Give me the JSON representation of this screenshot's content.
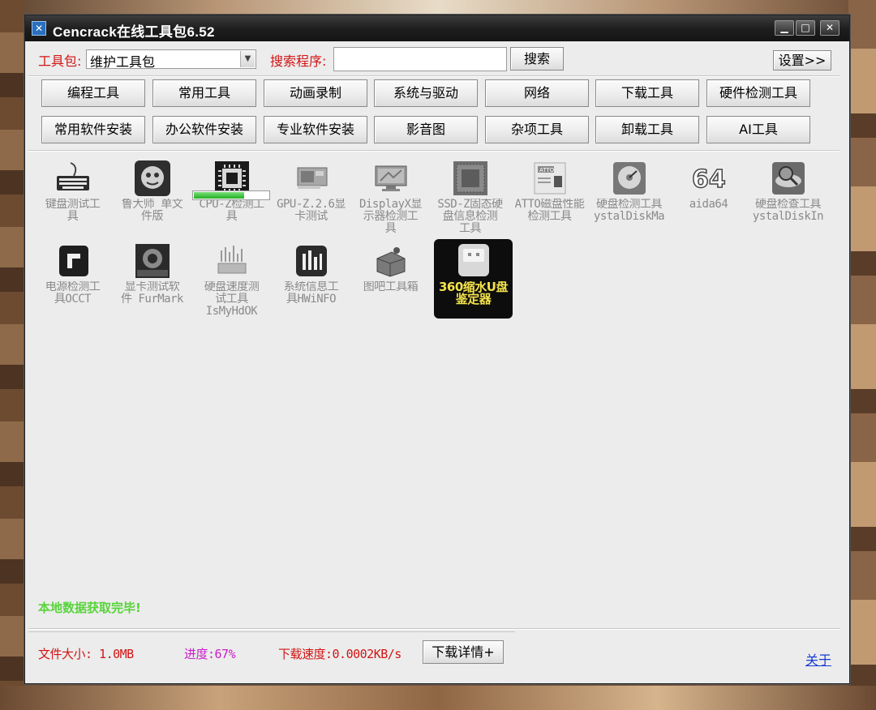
{
  "window": {
    "title": "Cencrack在线工具包6.52",
    "controls": [
      "minimize-icon",
      "maximize-icon",
      "close-icon"
    ]
  },
  "toolbar": {
    "toolkit_label": "工具包:",
    "toolkit_value": "维护工具包",
    "search_label": "搜索程序:",
    "search_value": "",
    "search_button": "搜索",
    "settings_button": "设置>>"
  },
  "categories": {
    "row1": [
      "编程工具",
      "常用工具",
      "动画录制",
      "系统与驱动",
      "网络",
      "下载工具",
      "硬件检测工具"
    ],
    "row2": [
      "常用软件安装",
      "办公软件安装",
      "专业软件安装",
      "影音图",
      "杂项工具",
      "卸载工具",
      "AI工具"
    ]
  },
  "tools": [
    {
      "label": "键盘测试工\n具",
      "icon": "keyboard-icon"
    },
    {
      "label": "鲁大师_单文\n件版",
      "icon": "ludashi-icon"
    },
    {
      "label": "CPU-Z检测工\n具",
      "icon": "cpu-chip-icon"
    },
    {
      "label": "GPU-Z.2.6显\n卡测试",
      "icon": "graphics-card-icon"
    },
    {
      "label": "DisplayX显\n示器检测工\n具",
      "icon": "monitor-icon"
    },
    {
      "label": "SSD-Z固态硬\n盘信息检测\n工具",
      "icon": "ssd-icon"
    },
    {
      "label": "ATTO磁盘性能\n检测工具",
      "icon": "atto-icon"
    },
    {
      "label": "硬盘检测工具\nystalDiskMa",
      "icon": "crystaldiskmark-icon"
    },
    {
      "label": "aida64",
      "icon": "aida64-icon"
    },
    {
      "label": "硬盘检查工具\nystalDiskIn",
      "icon": "crystaldiskinfo-icon"
    },
    {
      "label": "电源检测工\n具OCCT",
      "icon": "occt-icon"
    },
    {
      "label": "显卡测试软\n件 FurMark",
      "icon": "furmark-icon"
    },
    {
      "label": "硬盘速度测\n试工具\nIsMyHdOK",
      "icon": "hdd-speed-icon"
    },
    {
      "label": "系统信息工\n具HWiNFO",
      "icon": "hwinfo-icon"
    },
    {
      "label": "图吧工具箱",
      "icon": "toolbox-icon"
    },
    {
      "label": "360缩水U盘\n鉴定器",
      "icon": "usb-drive-icon"
    }
  ],
  "download_progress_fraction": 0.67,
  "status": {
    "message": "本地数据获取完毕!",
    "file_size": "文件大小: 1.0MB",
    "progress": "进度:67%",
    "speed": "下载速度:0.0002KB/s",
    "details_button": "下载详情+",
    "about_link": "关于"
  },
  "colors": {
    "label_red": "#d21414",
    "status_green": "#58d43a",
    "progress_magenta": "#c81ec8",
    "selected_text": "#f4e24b",
    "link_blue": "#1a3cd0"
  }
}
